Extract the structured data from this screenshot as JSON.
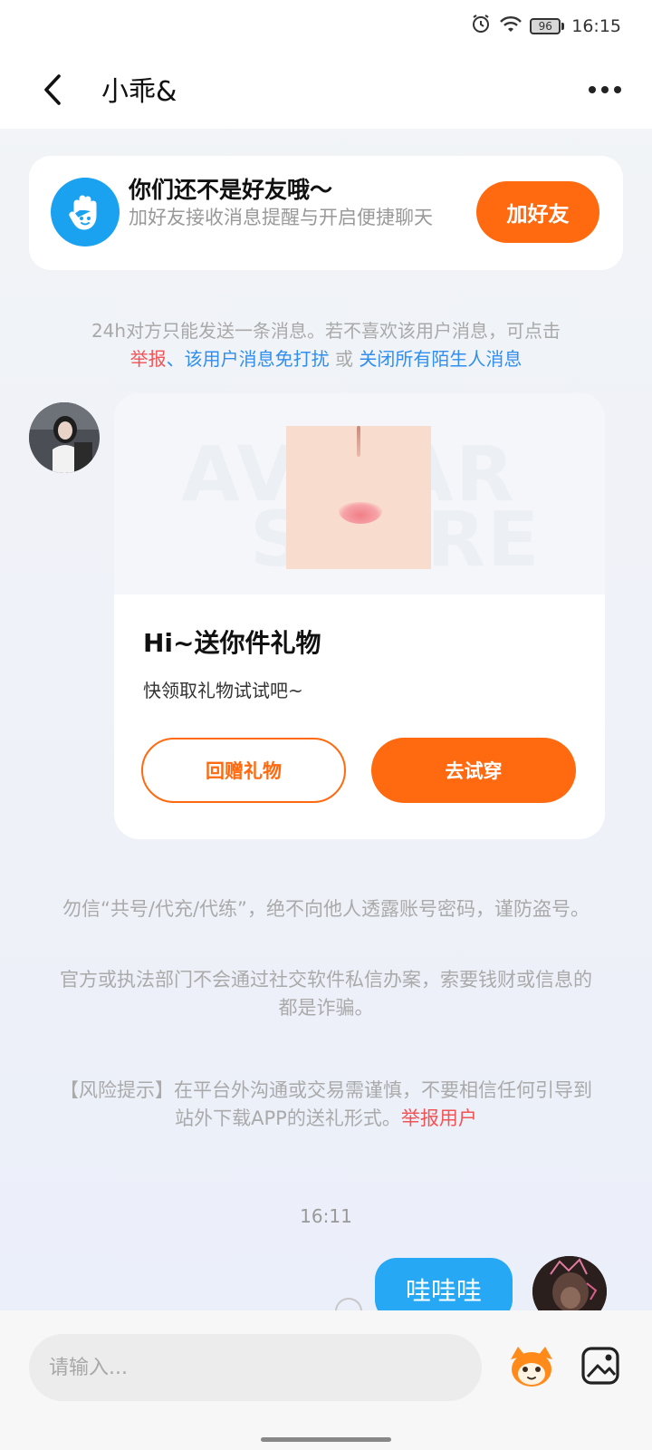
{
  "status_bar": {
    "battery": "96",
    "time": "16:15"
  },
  "header": {
    "title": "小乖&"
  },
  "friend_card": {
    "title": "你们还不是好友哦～",
    "description": "加好友接收消息提醒与开启便捷聊天",
    "button": "加好友"
  },
  "notice": {
    "text": "24h对方只能发送一条消息。若不喜欢该用户消息，可点击",
    "report": "举报",
    "sep1": "、",
    "mute": "该用户消息免打扰",
    "sep2": " 或 ",
    "close_all": "关闭所有陌生人消息"
  },
  "gift_card": {
    "watermark_line1": "AVATAR",
    "watermark_line2": "STORE",
    "title": "Hi~送你件礼物",
    "subtitle": "快领取礼物试试吧~",
    "return_button": "回赠礼物",
    "try_button": "去试穿"
  },
  "warnings": {
    "w1": "勿信“共号/代充/代练”，绝不向他人透露账号密码，谨防盗号。",
    "w2": "官方或执法部门不会通过社交软件私信办案，索要钱财或信息的都是诈骗。",
    "w3_text": "【风险提示】在平台外沟通或交易需谨慎，不要相信任何引导到站外下载APP的送礼形式。",
    "w3_link": "举报用户"
  },
  "timestamp": "16:11",
  "my_message": "哇哇哇",
  "input": {
    "placeholder": "请输入..."
  },
  "colors": {
    "accent": "#ff6a10",
    "blue": "#2f8ef0",
    "red": "#f25355",
    "bubble": "#26a8f5"
  }
}
